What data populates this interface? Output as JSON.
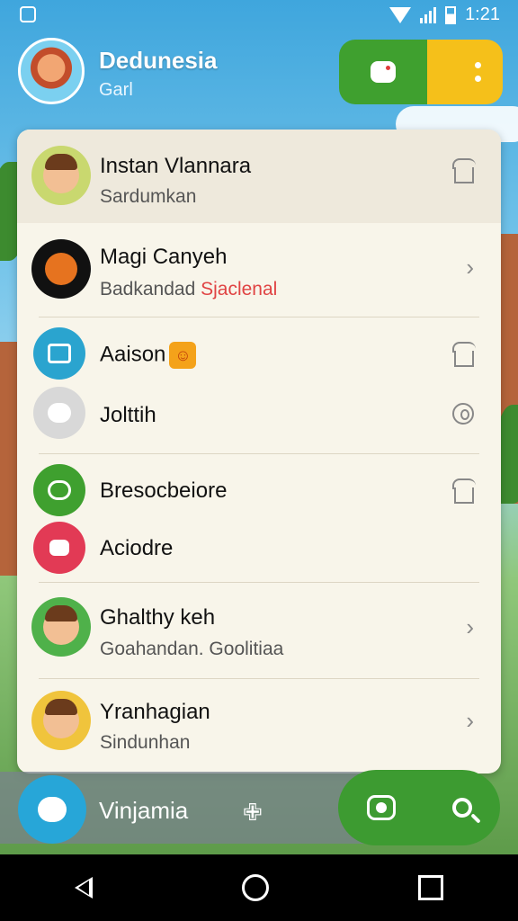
{
  "status_bar": {
    "time": "1:21"
  },
  "header": {
    "title": "Dedunesia",
    "subtitle": "Garl"
  },
  "list": [
    {
      "title": "Instan Vlannara",
      "subtitle": "Sardumkan",
      "trailing": "house-icon",
      "highlight": true
    },
    {
      "title": "Magi Canyeh",
      "subtitle": "Badkandad",
      "subtitle_accent": "Sjaclenal",
      "trailing": "chevron-right-icon"
    },
    {
      "title": "Aaison",
      "subtitle": "",
      "trailing": "house-icon"
    },
    {
      "title": "Jolttih",
      "subtitle": "",
      "trailing": "circle-icon"
    },
    {
      "title": "Bresocbeiore",
      "subtitle": "",
      "trailing": "house-icon"
    },
    {
      "title": "Aciodre",
      "subtitle": ""
    },
    {
      "title": "Ghalthy keh",
      "subtitle": "Goahandan. Goolitiaa",
      "trailing": "chevron-right-icon"
    },
    {
      "title": "Yranhagian",
      "subtitle": "Sindunhan",
      "trailing": "chevron-right-icon"
    }
  ],
  "bottom_bar": {
    "label": "Vinjamia"
  },
  "colors": {
    "green": "#3d9b31",
    "yellow": "#f5c01a",
    "blue": "#27a6d8",
    "accent_red": "#e04343"
  }
}
